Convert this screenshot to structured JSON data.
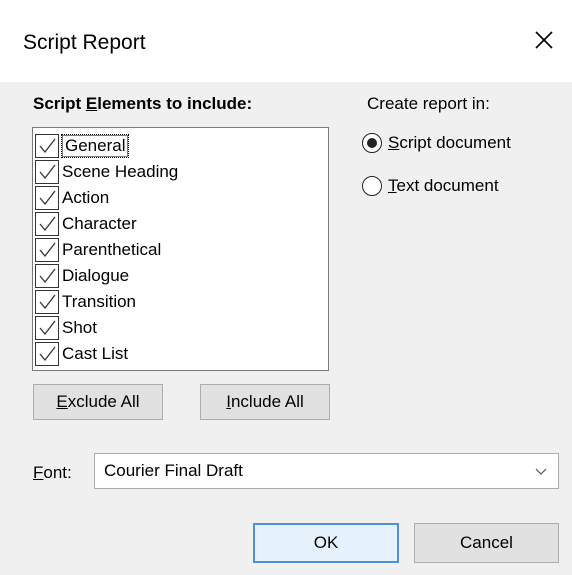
{
  "window": {
    "title": "Script Report"
  },
  "elements_section": {
    "label_pre": "Script ",
    "label_mnemonic": "E",
    "label_post": "lements to include:",
    "items": [
      {
        "label": "General",
        "checked": true
      },
      {
        "label": "Scene Heading",
        "checked": true
      },
      {
        "label": "Action",
        "checked": true
      },
      {
        "label": "Character",
        "checked": true
      },
      {
        "label": "Parenthetical",
        "checked": true
      },
      {
        "label": "Dialogue",
        "checked": true
      },
      {
        "label": "Transition",
        "checked": true
      },
      {
        "label": "Shot",
        "checked": true
      },
      {
        "label": "Cast List",
        "checked": true
      }
    ]
  },
  "buttons": {
    "exclude_all_mnemonic": "E",
    "exclude_all_rest": "xclude All",
    "include_all_mnemonic": "I",
    "include_all_rest": "nclude All",
    "ok": "OK",
    "cancel": "Cancel"
  },
  "create_in": {
    "label": "Create report in:",
    "options": [
      {
        "mnemonic": "S",
        "rest": "cript document",
        "selected": true
      },
      {
        "mnemonic": "T",
        "rest": "ext document",
        "selected": false
      }
    ]
  },
  "font": {
    "label_mnemonic": "F",
    "label_rest": "ont:",
    "value": "Courier Final Draft"
  },
  "icons": {
    "close": "close-icon",
    "check": "checkmark-icon",
    "dropdown": "chevron-down-icon"
  },
  "colors": {
    "default_button_border": "#4f8fd6"
  }
}
